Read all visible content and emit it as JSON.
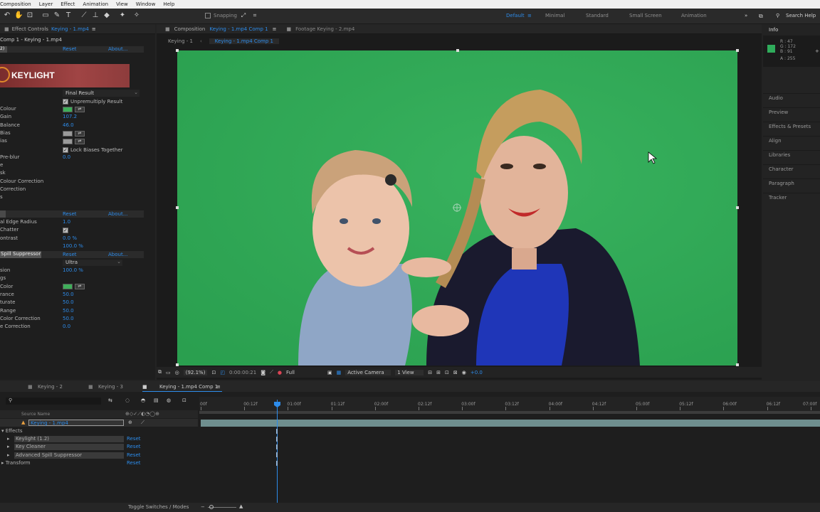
{
  "menubar": [
    "Composition",
    "Layer",
    "Effect",
    "Animation",
    "View",
    "Window",
    "Help"
  ],
  "toolbar": {
    "snapping_label": "Snapping",
    "workspaces": [
      "Default",
      "Minimal",
      "Standard",
      "Small Screen",
      "Animation"
    ],
    "active_workspace": "Default",
    "search_help": "Search Help"
  },
  "effect_controls": {
    "tab_label": "Effect Controls",
    "tab_layer": "Keying - 1.mp4",
    "breadcrumb": "Comp 1 - Keying - 1.mp4",
    "reset": "Reset",
    "about": "About...",
    "keylight_logo": "KEYLIGHT",
    "view_value": "Final Result",
    "unpremultiply_label": "Unpremultiply Result",
    "rows": [
      {
        "label": "Colour",
        "value": ""
      },
      {
        "label": "Gain",
        "value": "107.2"
      },
      {
        "label": "Balance",
        "value": "46.0"
      },
      {
        "label": "Bias",
        "value": ""
      },
      {
        "label": "ias",
        "value": ""
      },
      {
        "label": "",
        "value": ""
      },
      {
        "label": "Pre-blur",
        "value": "0.0"
      },
      {
        "label": "e",
        "value": ""
      },
      {
        "label": "sk",
        "value": ""
      },
      {
        "label": "Colour Correction",
        "value": ""
      },
      {
        "label": "Correction",
        "value": ""
      },
      {
        "label": "s",
        "value": ""
      }
    ],
    "lock_biases_label": "Lock Biases Together",
    "key_cleaner": {
      "reset": "Reset",
      "about": "About...",
      "rows": [
        {
          "label": "al Edge Radius",
          "value": "1.0"
        },
        {
          "label": "Chatter",
          "value": ""
        },
        {
          "label": "ontrast",
          "value": "0.0 %"
        },
        {
          "label": "",
          "value": "100.0 %"
        }
      ]
    },
    "spill": {
      "title": "Spill Suppressor",
      "reset": "Reset",
      "about": "About...",
      "quality": "Ultra",
      "rows": [
        {
          "label": "sion",
          "value": "100.0 %"
        },
        {
          "label": "gs",
          "value": ""
        },
        {
          "label": "Color",
          "value": ""
        },
        {
          "label": "rance",
          "value": "50.0"
        },
        {
          "label": "turate",
          "value": "50.0"
        },
        {
          "label": "Range",
          "value": "50.0"
        },
        {
          "label": "Color Correction",
          "value": "50.0"
        },
        {
          "label": "e Correction",
          "value": "0.0"
        }
      ]
    }
  },
  "composition": {
    "tab_label": "Composition",
    "tab_comp": "Keying - 1.mp4 Comp 1",
    "footage_tab": "Footage  Keying - 2.mp4",
    "crumb_1": "Keying - 1",
    "crumb_2": "Keying - 1.mp4 Comp 1",
    "zoom": "(92.1%)",
    "timecode": "0:00:00:21",
    "resolution": "Full",
    "camera": "Active Camera",
    "views": "1 View",
    "exposure": "+0.0"
  },
  "info_panel": {
    "title": "Info",
    "r": "R : 47",
    "g": "G : 172",
    "b": "B : 91",
    "a": "A : 255",
    "color": "#2fac5b",
    "panels": [
      "Audio",
      "Preview",
      "Effects & Presets",
      "Align",
      "Libraries",
      "Character",
      "Paragraph",
      "Tracker"
    ]
  },
  "timeline": {
    "tabs": [
      "Keying - 2",
      "Keying - 3",
      "Keying - 1.mp4 Comp 1"
    ],
    "source_name_header": "Source Name",
    "layer_name": "Keying - 1.mp4",
    "effects_label": "Effects",
    "effects": [
      {
        "name": "Keylight (1.2)",
        "reset": "Reset"
      },
      {
        "name": "Key Cleaner",
        "reset": "Reset"
      },
      {
        "name": "Advanced Spill Suppressor",
        "reset": "Reset"
      }
    ],
    "transform_label": "Transform",
    "transform_reset": "Reset",
    "ruler": [
      "00f",
      "00:12f",
      "01:00f",
      "01:12f",
      "02:00f",
      "02:12f",
      "03:00f",
      "03:12f",
      "04:00f",
      "04:12f",
      "05:00f",
      "05:12f",
      "06:00f",
      "06:12f",
      "07:00f"
    ],
    "toggle_label": "Toggle Switches / Modes"
  },
  "colors": {
    "accent": "#2d8ceb",
    "green_screen": "#2fae58",
    "keylight_banner": "#8b3a3a"
  }
}
